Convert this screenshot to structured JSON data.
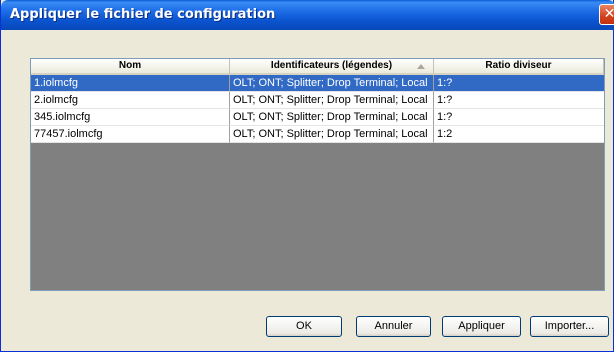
{
  "window": {
    "title": "Appliquer le fichier de configuration",
    "close_glyph": "✕"
  },
  "table": {
    "columns": [
      "Nom",
      "Identificateurs (légendes)",
      "Ratio diviseur"
    ],
    "rows": [
      {
        "name": "1.iolmcfg",
        "ids": "OLT; ONT; Splitter; Drop Terminal; Local",
        "ratio": "1:?",
        "selected": true
      },
      {
        "name": "2.iolmcfg",
        "ids": "OLT; ONT; Splitter; Drop Terminal; Local",
        "ratio": "1:?",
        "selected": false
      },
      {
        "name": "345.iolmcfg",
        "ids": "OLT; ONT; Splitter; Drop Terminal; Local",
        "ratio": "1:?",
        "selected": false
      },
      {
        "name": "77457.iolmcfg",
        "ids": "OLT; ONT; Splitter; Drop Terminal; Local",
        "ratio": "1:2",
        "selected": false
      }
    ]
  },
  "buttons": {
    "ok": "OK",
    "cancel": "Annuler",
    "apply": "Appliquer",
    "import": "Importer..."
  },
  "colors": {
    "selection": "#316ac5",
    "grid_background": "#808080",
    "titlebar": "#0a53cf"
  }
}
